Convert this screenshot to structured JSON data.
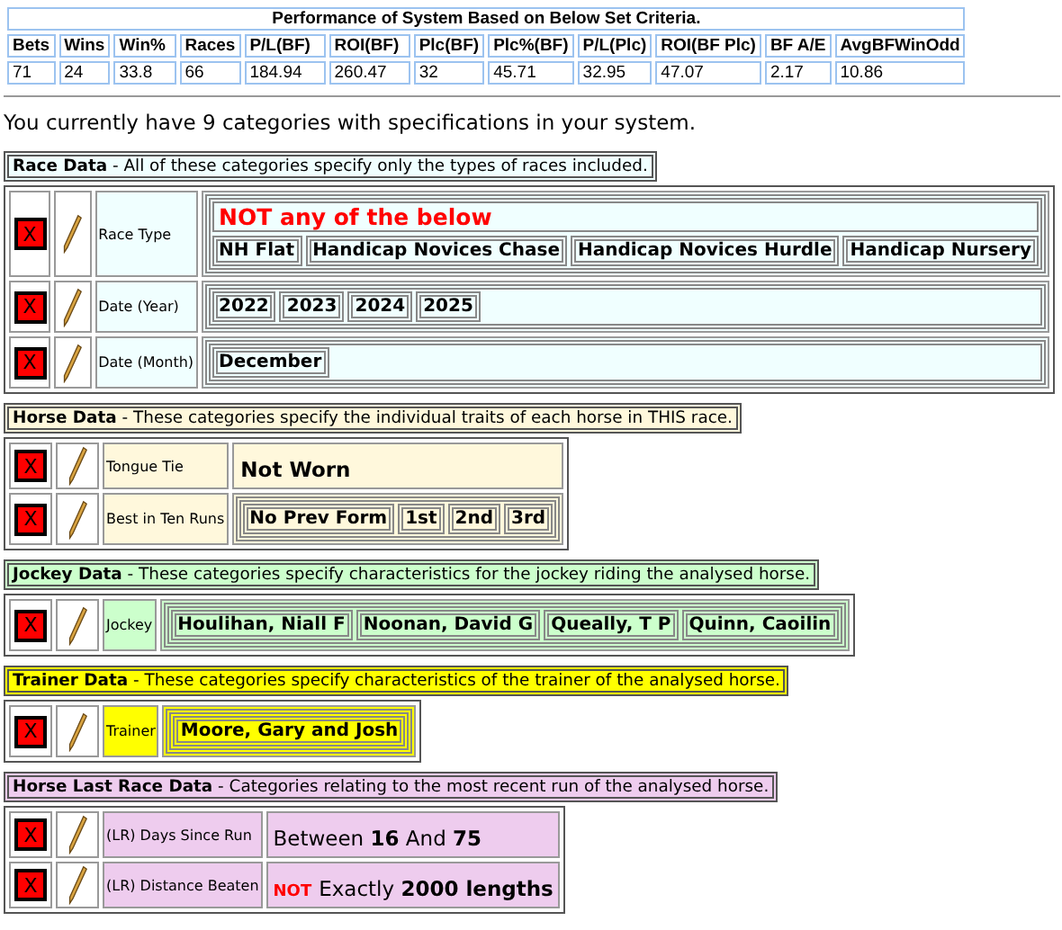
{
  "performance": {
    "title": "Performance of System Based on Below Set Criteria.",
    "columns": [
      "Bets",
      "Wins",
      "Win%",
      "Races",
      "P/L(BF)",
      "ROI(BF)",
      "Plc(BF)",
      "Plc%(BF)",
      "P/L(Plc)",
      "ROI(BF Plc)",
      "BF A/E",
      "AvgBFWinOdd"
    ],
    "values": [
      "71",
      "24",
      "33.8",
      "66",
      "184.94",
      "260.47",
      "32",
      "45.71",
      "32.95",
      "47.07",
      "2.17",
      "10.86"
    ]
  },
  "summary": "You currently have 9 categories with specifications in your system.",
  "sections": [
    {
      "heading": "**Race Data** - All of these categories specify only the types of races included.",
      "color": "#f0ffff",
      "full_width": true,
      "rows": [
        {
          "delete_label": "X",
          "label": "Race Type",
          "value": {
            "kind": "chips",
            "heading": "NOT any of the below",
            "chips": [
              "NH Flat",
              "Handicap Novices Chase",
              "Handicap Novices Hurdle",
              "Handicap Nursery"
            ]
          }
        },
        {
          "delete_label": "X",
          "label": "Date (Year)",
          "value": {
            "kind": "chips",
            "chips": [
              "2022",
              "2023",
              "2024",
              "2025"
            ]
          }
        },
        {
          "delete_label": "X",
          "label": "Date (Month)",
          "value": {
            "kind": "chips",
            "chips": [
              "December"
            ]
          }
        }
      ]
    },
    {
      "heading": "**Horse Data** - These categories specify the individual traits of each horse in THIS race.",
      "color": "#fff8dc",
      "full_width": false,
      "rows": [
        {
          "delete_label": "X",
          "label": "Tongue Tie",
          "value": {
            "kind": "text",
            "text": "Not Worn"
          }
        },
        {
          "delete_label": "X",
          "label": "Best in Ten Runs",
          "value": {
            "kind": "chips",
            "chips": [
              "No Prev Form",
              "1st",
              "2nd",
              "3rd"
            ]
          }
        }
      ]
    },
    {
      "heading": "**Jockey Data** - These categories specify characteristics for the jockey riding the analysed horse.",
      "color": "#ccffcc",
      "full_width": false,
      "rows": [
        {
          "delete_label": "X",
          "label": "Jockey",
          "value": {
            "kind": "chips",
            "chips": [
              "Houlihan, Niall F",
              "Noonan, David G",
              "Queally, T P",
              "Quinn, Caoilin"
            ]
          }
        }
      ]
    },
    {
      "heading": "**Trainer Data** - These categories specify characteristics of the trainer of the analysed horse.",
      "color": "#ffff00",
      "full_width": false,
      "rows": [
        {
          "delete_label": "X",
          "label": "Trainer",
          "value": {
            "kind": "chips",
            "chips": [
              "Moore, Gary and Josh"
            ]
          }
        }
      ]
    },
    {
      "heading": "**Horse Last Race Data** - Categories relating to the most recent run of the analysed horse.",
      "color": "#eeccee",
      "full_width": false,
      "rows": [
        {
          "delete_label": "X",
          "label": "(LR) Days Since Run",
          "value": {
            "kind": "rich",
            "text": "Between **16** And **75**"
          }
        },
        {
          "delete_label": "X",
          "label": "(LR) Distance Beaten",
          "value": {
            "kind": "rich",
            "prefix": "NOT",
            "text": "Exactly **2000 lengths**"
          }
        }
      ]
    }
  ]
}
